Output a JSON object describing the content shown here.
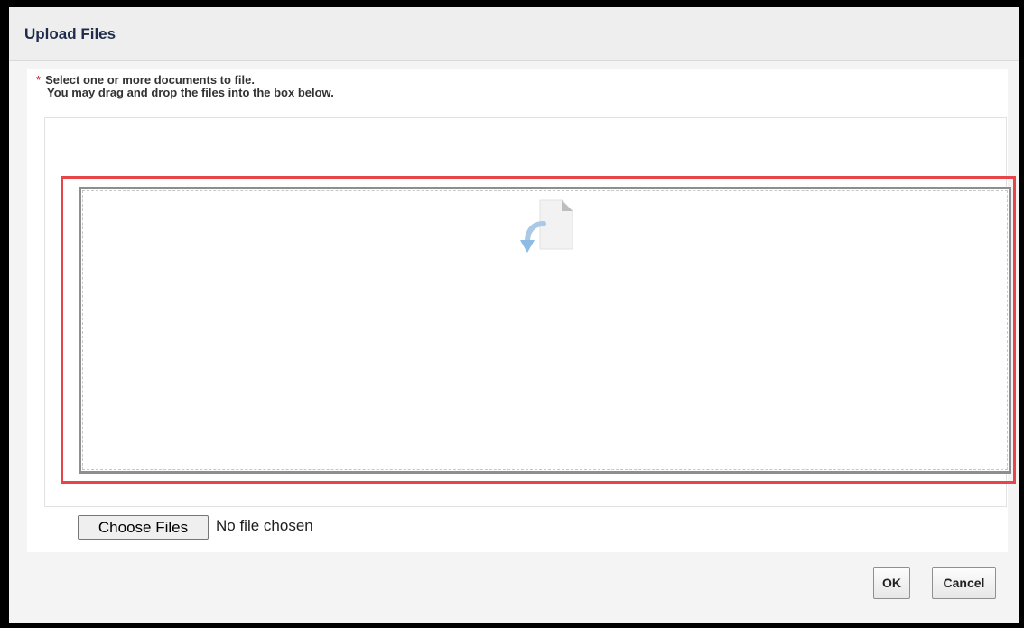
{
  "dialog": {
    "title": "Upload Files",
    "required_marker": "*",
    "instruction_line1": "Select one or more documents to file.",
    "instruction_line2": "You may drag and drop the files into the box below.",
    "dropzone": {
      "icon": "file-drop-icon",
      "highlight_color": "#e8454a"
    },
    "file_input": {
      "button_label": "Choose Files",
      "status": "No file chosen"
    },
    "buttons": {
      "ok_label": "OK",
      "cancel_label": "Cancel"
    }
  }
}
